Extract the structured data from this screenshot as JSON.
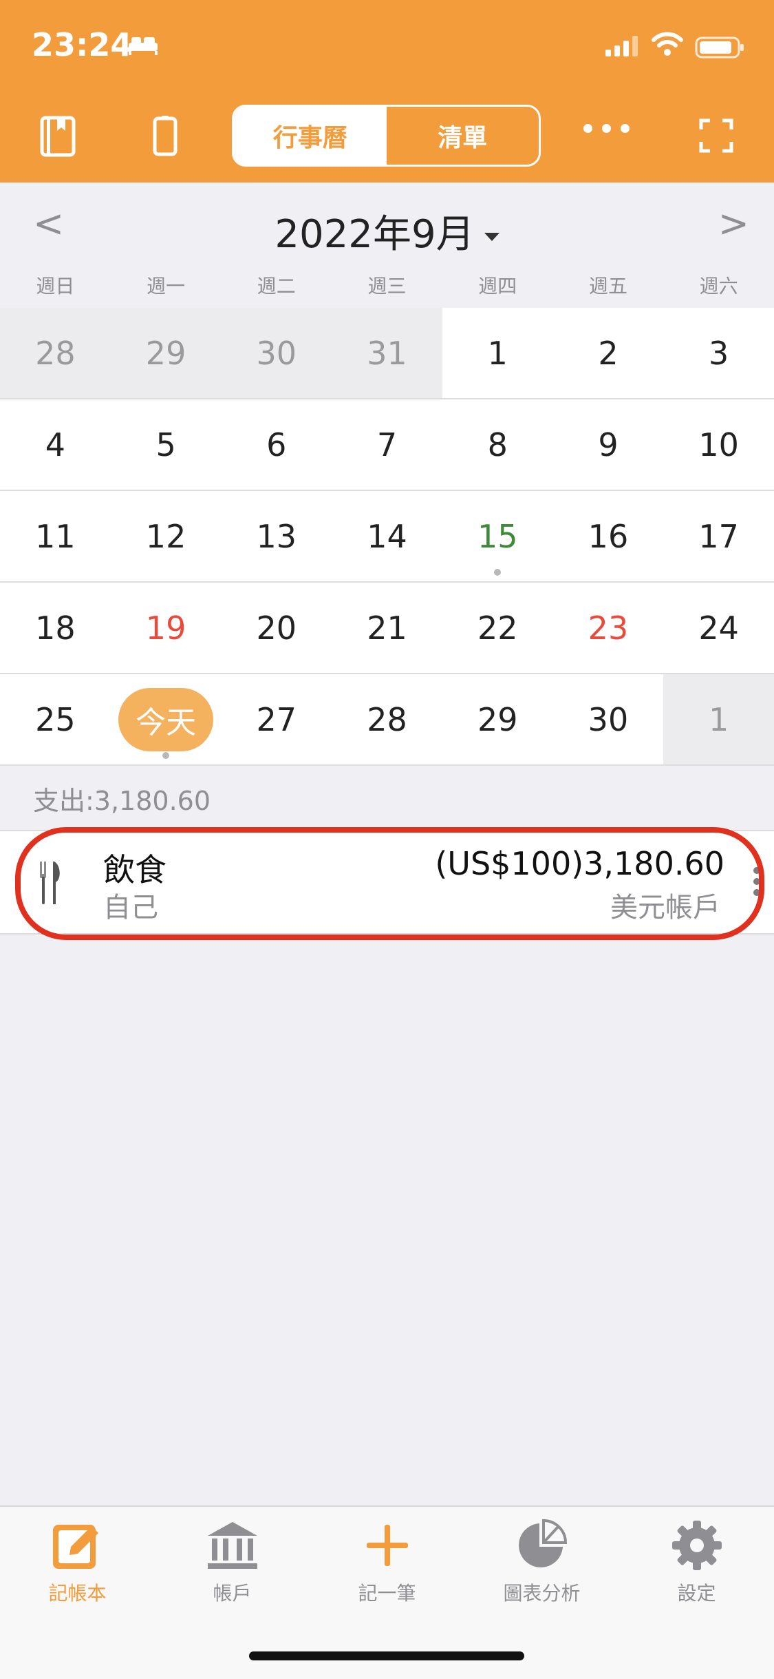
{
  "status_bar": {
    "time": "23:24"
  },
  "toolbar": {
    "segments": [
      {
        "label": "行事曆",
        "active": true
      },
      {
        "label": "清單",
        "active": false
      }
    ]
  },
  "calendar": {
    "month_title": "2022年9月",
    "weekdays": [
      "週日",
      "週一",
      "週二",
      "週三",
      "週四",
      "週五",
      "週六"
    ],
    "weeks": [
      [
        {
          "d": "28",
          "state": "muted"
        },
        {
          "d": "29",
          "state": "muted"
        },
        {
          "d": "30",
          "state": "muted"
        },
        {
          "d": "31",
          "state": "muted"
        },
        {
          "d": "1"
        },
        {
          "d": "2"
        },
        {
          "d": "3"
        }
      ],
      [
        {
          "d": "4"
        },
        {
          "d": "5"
        },
        {
          "d": "6"
        },
        {
          "d": "7"
        },
        {
          "d": "8"
        },
        {
          "d": "9"
        },
        {
          "d": "10"
        }
      ],
      [
        {
          "d": "11"
        },
        {
          "d": "12"
        },
        {
          "d": "13"
        },
        {
          "d": "14"
        },
        {
          "d": "15",
          "state": "green",
          "dot": true
        },
        {
          "d": "16"
        },
        {
          "d": "17"
        }
      ],
      [
        {
          "d": "18"
        },
        {
          "d": "19",
          "state": "red"
        },
        {
          "d": "20"
        },
        {
          "d": "21"
        },
        {
          "d": "22"
        },
        {
          "d": "23",
          "state": "red"
        },
        {
          "d": "24"
        }
      ],
      [
        {
          "d": "25"
        },
        {
          "d": "今天",
          "state": "today",
          "dot": true
        },
        {
          "d": "27"
        },
        {
          "d": "28"
        },
        {
          "d": "29"
        },
        {
          "d": "30"
        },
        {
          "d": "1",
          "state": "muted"
        }
      ]
    ]
  },
  "summary": {
    "text": "支出:3,180.60"
  },
  "transactions": [
    {
      "category": "飲食",
      "member": "自己",
      "amount": "(US$100)3,180.60",
      "account": "美元帳戶",
      "icon": "fork-knife-icon"
    }
  ],
  "tabbar": {
    "items": [
      {
        "label": "記帳本",
        "icon": "edit-book-icon",
        "active": true
      },
      {
        "label": "帳戶",
        "icon": "bank-icon",
        "active": false
      },
      {
        "label": "記一筆",
        "icon": "plus-icon",
        "active": false
      },
      {
        "label": "圖表分析",
        "icon": "pie-chart-icon",
        "active": false
      },
      {
        "label": "設定",
        "icon": "gear-icon",
        "active": false
      }
    ]
  },
  "colors": {
    "accent": "#f29c3b",
    "highlight": "#e0301e",
    "green": "#3f8a3a",
    "red": "#e84a3b"
  }
}
